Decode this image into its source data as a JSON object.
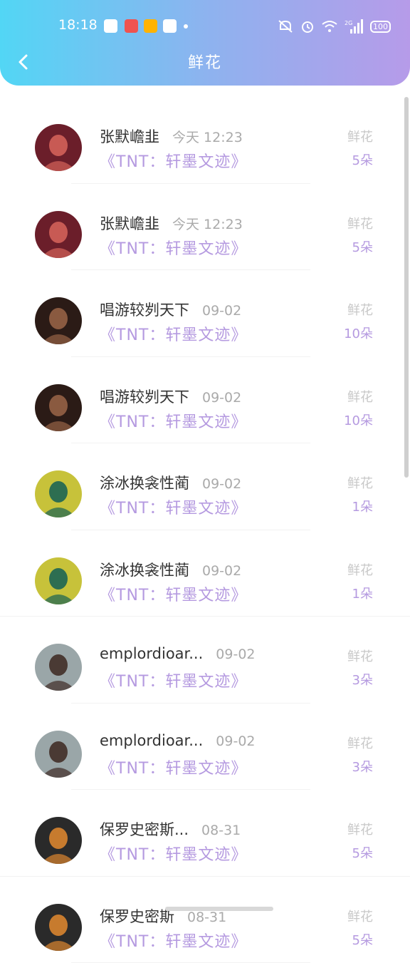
{
  "status_bar": {
    "time": "18:18",
    "battery": "100",
    "network": "2G"
  },
  "header": {
    "title": "鲜花",
    "accent_gradient": [
      "#52d6f5",
      "#b69be9"
    ]
  },
  "gift_label": "鲜花",
  "items": [
    {
      "name": "张默嶦韭",
      "time": "今天 12:23",
      "book": "《TNT：轩墨文迹》",
      "count": "5朵",
      "avatar_colors": [
        "#6b1e2a",
        "#c85a54"
      ]
    },
    {
      "name": "张默嶦韭",
      "time": "今天 12:23",
      "book": "《TNT：轩墨文迹》",
      "count": "5朵",
      "avatar_colors": [
        "#6b1e2a",
        "#c85a54"
      ]
    },
    {
      "name": "唱游较刿天下",
      "time": "09-02",
      "book": "《TNT：轩墨文迹》",
      "count": "10朵",
      "avatar_colors": [
        "#2b1b16",
        "#8a5a40"
      ]
    },
    {
      "name": "唱游较刿天下",
      "time": "09-02",
      "book": "《TNT：轩墨文迹》",
      "count": "10朵",
      "avatar_colors": [
        "#2b1b16",
        "#8a5a40"
      ]
    },
    {
      "name": "涂冰换衾性蔺",
      "time": "09-02",
      "book": "《TNT：轩墨文迹》",
      "count": "1朵",
      "avatar_colors": [
        "#c7c23a",
        "#2d6e51"
      ]
    },
    {
      "name": "涂冰换衾性蔺",
      "time": "09-02",
      "book": "《TNT：轩墨文迹》",
      "count": "1朵",
      "avatar_colors": [
        "#c7c23a",
        "#2d6e51"
      ]
    },
    {
      "name": "emplordioar...",
      "time": "09-02",
      "book": "《TNT：轩墨文迹》",
      "count": "3朵",
      "avatar_colors": [
        "#9aa6a8",
        "#4a3a34"
      ]
    },
    {
      "name": "emplordioar...",
      "time": "09-02",
      "book": "《TNT：轩墨文迹》",
      "count": "3朵",
      "avatar_colors": [
        "#9aa6a8",
        "#4a3a34"
      ]
    },
    {
      "name": "保罗史密斯...",
      "time": "08-31",
      "book": "《TNT：轩墨文迹》",
      "count": "5朵",
      "avatar_colors": [
        "#2a2a2a",
        "#c77b2e"
      ]
    },
    {
      "name": "保罗史密斯",
      "time": "08-31",
      "book": "《TNT：轩墨文迹》",
      "count": "5朵",
      "avatar_colors": [
        "#2a2a2a",
        "#c77b2e"
      ]
    }
  ]
}
